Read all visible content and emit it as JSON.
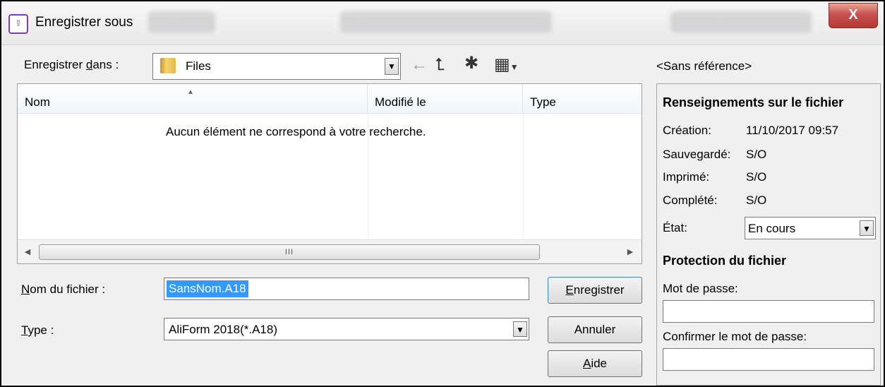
{
  "window": {
    "title": "Enregistrer sous",
    "close_label": "X",
    "background_tabs": [
      "Nom",
      "Demande conjointe",
      "Dossier de la C"
    ]
  },
  "location": {
    "label_pre": "Enregistrer ",
    "label_accel": "d",
    "label_post": "ans :",
    "folder": "Files",
    "folder_icon": "folder-icon"
  },
  "toolbar": {
    "back_icon": "←",
    "up_icon": "⮤",
    "new_folder_icon": "✱",
    "view_icon": "▦"
  },
  "reference": "<Sans référence>",
  "file_list": {
    "columns": [
      "Nom",
      "Modifié le",
      "Type"
    ],
    "empty_message": "Aucun élément ne correspond à votre recherche.",
    "scroll_grip": "III"
  },
  "filename": {
    "label_accel": "N",
    "label_post": "om du fichier :",
    "value": "SansNom.A18"
  },
  "filetype": {
    "label_accel": "T",
    "label_post": "ype :",
    "value": "AliForm 2018(*.A18)"
  },
  "buttons": {
    "save_accel": "E",
    "save_post": "nregistrer",
    "cancel": "Annuler",
    "help_accel": "A",
    "help_post": "ide"
  },
  "file_info": {
    "heading": "Renseignements sur le fichier",
    "rows": [
      {
        "label": "Création:",
        "value": "11/10/2017 09:57"
      },
      {
        "label": "Sauvegardé:",
        "value": "S/O"
      },
      {
        "label": "Imprimé:",
        "value": "S/O"
      },
      {
        "label": "Complété:",
        "value": "S/O"
      }
    ],
    "state_label": "État:",
    "state_value": "En cours"
  },
  "protection": {
    "heading": "Protection du fichier",
    "password_label": "Mot de passe:",
    "password_value": "",
    "confirm_label": "Confirmer le mot de passe:",
    "confirm_value": ""
  },
  "colors": {
    "selection": "#3399ff",
    "title_icon": "#7b3fb3",
    "close": "#c75050"
  }
}
